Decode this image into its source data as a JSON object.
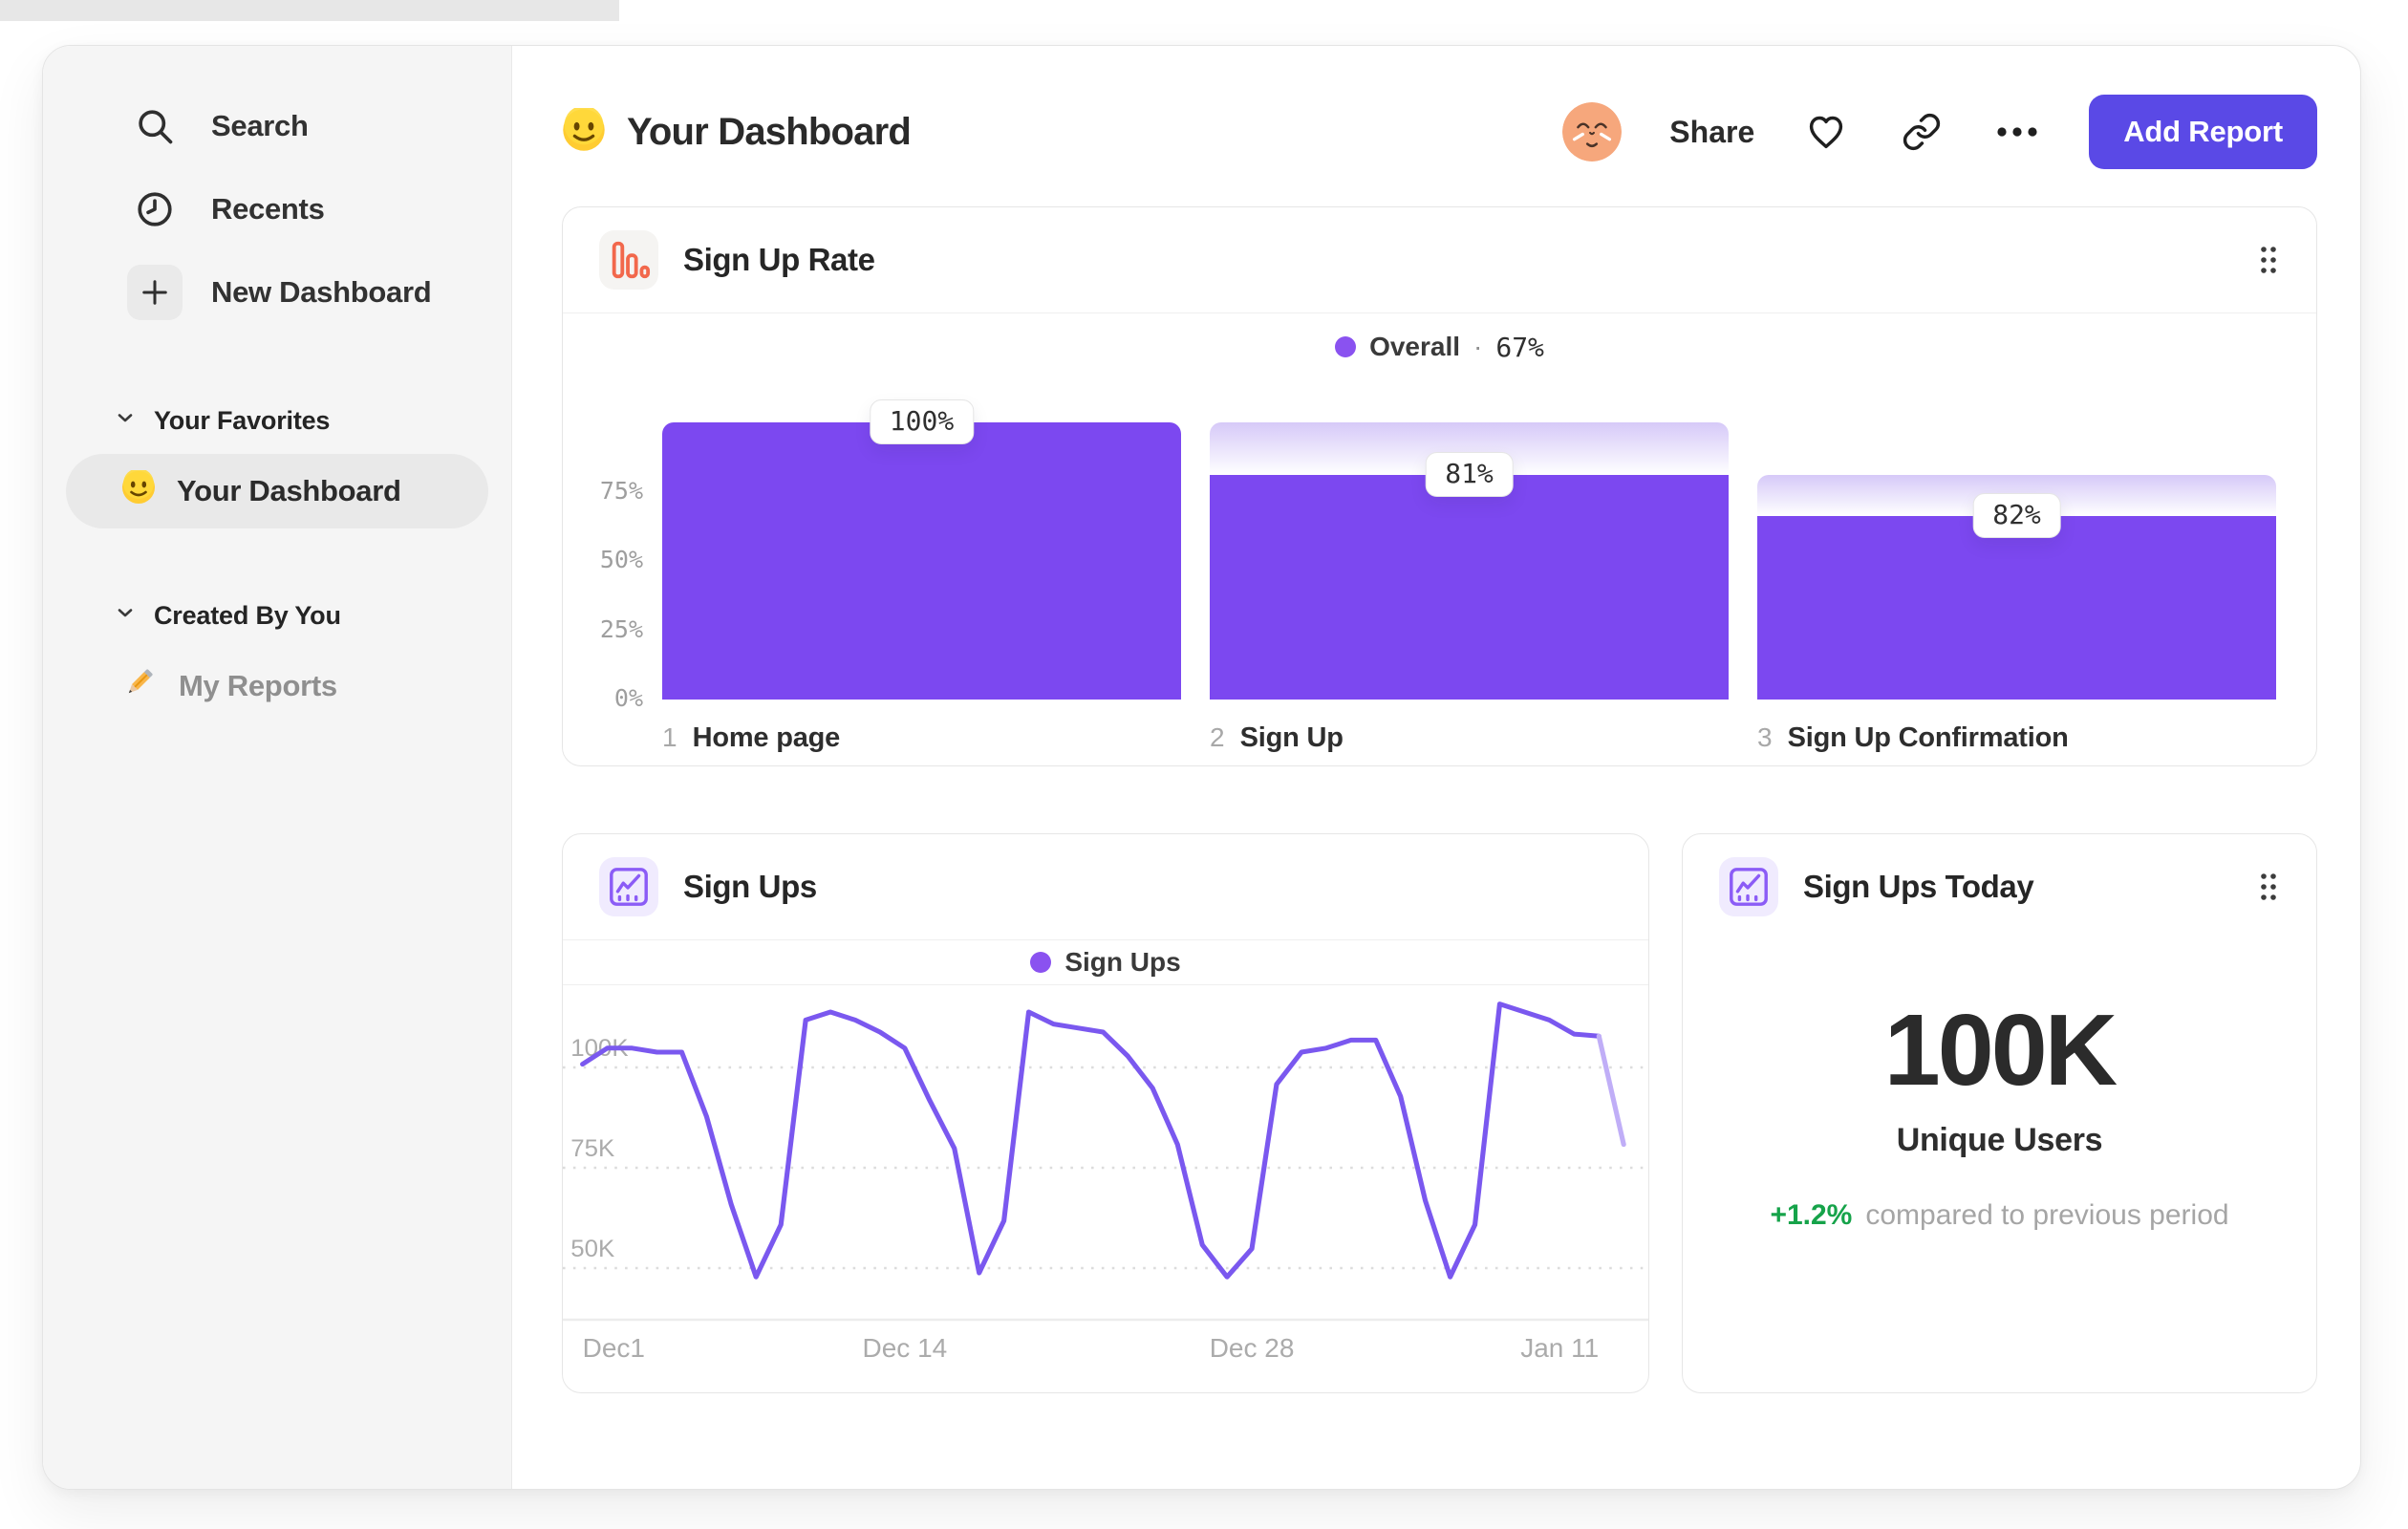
{
  "colors": {
    "accent": "#5A49E6",
    "bar_purple": "#7C48F0",
    "bar_gradient_top": "#D6C9F8",
    "legend_dot": "#8A52F0",
    "line_purple": "#7A58EF",
    "line_faded": "#C0AEF7",
    "icon_orange": "#F2684C",
    "icon_purple": "#8B5CF6",
    "delta_green": "#16A34A",
    "avatar_peach": "#F6A77C"
  },
  "sidebar": {
    "primary": [
      {
        "label": "Search",
        "icon": "search-icon"
      },
      {
        "label": "Recents",
        "icon": "clock-icon"
      },
      {
        "label": "New Dashboard",
        "icon": "plus-icon"
      }
    ],
    "sections": [
      {
        "title": "Your Favorites",
        "items": [
          {
            "label": "Your Dashboard",
            "emoji": "slightly-smiling-face",
            "selected": true
          }
        ]
      },
      {
        "title": "Created By You",
        "items": [
          {
            "label": "My Reports",
            "emoji": "pencil",
            "selected": false
          }
        ]
      }
    ]
  },
  "header": {
    "emoji": "slightly-smiling-face",
    "title": "Your Dashboard",
    "share_label": "Share",
    "add_report_label": "Add Report",
    "icons": [
      "avatar",
      "heart-icon",
      "link-icon",
      "ellipsis-icon"
    ]
  },
  "chart_data": [
    {
      "type": "bar",
      "subtype": "funnel",
      "title": "Sign Up Rate",
      "legend": "Overall",
      "legend_separator": "·",
      "overall_value": "67%",
      "categories": [
        "Home page",
        "Sign Up",
        "Sign Up Confirmation"
      ],
      "step_numbers": [
        "1",
        "2",
        "3"
      ],
      "step_conversion_labels": [
        "100%",
        "81%",
        "82%"
      ],
      "step_conversion_pct": [
        100,
        81,
        82
      ],
      "bar_height_pct": [
        100,
        81,
        66.4
      ],
      "y_ticks": [
        "75%",
        "50%",
        "25%",
        "0%"
      ],
      "y_tick_pct": [
        75,
        50,
        25,
        0
      ],
      "ylim": [
        0,
        107
      ],
      "grid": false,
      "legend_position": "top-center"
    },
    {
      "type": "line",
      "title": "Sign Ups",
      "legend": "Sign Ups",
      "unit": "thousands",
      "x_ticks": [
        "Dec1",
        "Dec 14",
        "Dec 28",
        "Jan 11"
      ],
      "x_tick_indices": [
        0,
        13,
        27,
        41
      ],
      "y_ticks": [
        "100K",
        "75K",
        "50K"
      ],
      "y_tick_values": [
        100,
        75,
        50
      ],
      "ylim": [
        40,
        115
      ],
      "grid": "dotted-horizontal",
      "legend_position": "top-center",
      "values": [
        97,
        101,
        101,
        100,
        100,
        84,
        62,
        44,
        57,
        108,
        110,
        108,
        105,
        101,
        88,
        76,
        45,
        58,
        110,
        107,
        106,
        105,
        99,
        91,
        77,
        52,
        44,
        51,
        92,
        100,
        101,
        103,
        103,
        89,
        63,
        44,
        57,
        112,
        110,
        108,
        104.5,
        104,
        77
      ],
      "faded_tail_segments": 1
    },
    {
      "type": "stat",
      "title": "Sign Ups Today",
      "value": "100K",
      "label": "Unique Users",
      "delta": "+1.2%",
      "delta_direction": "up",
      "comparison_text": "compared to previous period"
    }
  ]
}
